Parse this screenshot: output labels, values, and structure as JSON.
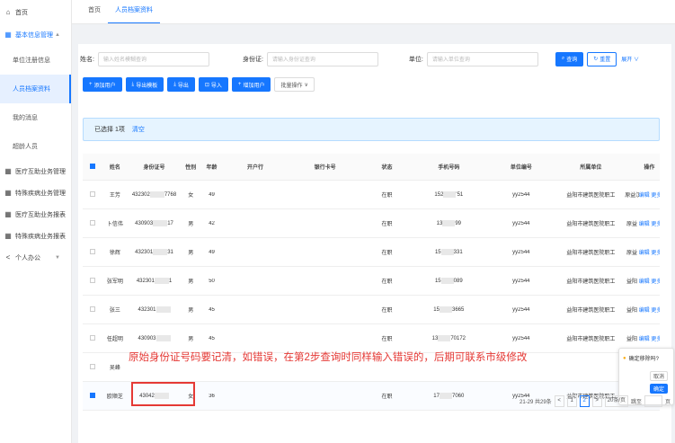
{
  "sidebar": {
    "home": "首页",
    "group1": "基本信息管理",
    "subs": [
      "单位注册信息",
      "人员档案资料",
      "我的消息",
      "超龄人员"
    ],
    "groups": [
      "医疗互助业务管理",
      "特殊疾病业务管理",
      "医疗互助业务报表",
      "特殊疾病业务报表",
      "个人办公"
    ]
  },
  "tabs": [
    "首页",
    "人员档案资料"
  ],
  "search": {
    "name_label": "姓名:",
    "name_ph": "输入姓名模糊查询",
    "id_label": "身份证:",
    "id_ph": "请输入身份证查询",
    "unit_label": "单位:",
    "unit_ph": "请输入单位查询",
    "query": "查询",
    "reset": "重置",
    "expand": "展开"
  },
  "toolbar": {
    "add": "添加用户",
    "tpl": "导出模板",
    "export": "导出",
    "import": "导入",
    "batch_add": "增加用户",
    "batch": "批量操作"
  },
  "selection": {
    "text": "已选择 1项",
    "clear": "清空"
  },
  "table": {
    "headers": [
      "姓名",
      "身份证号",
      "性别",
      "年龄",
      "开户行",
      "银行卡号",
      "状态",
      "手机号码",
      "单位编号",
      "所属单位",
      "",
      "操作"
    ],
    "rows": [
      {
        "name": "王芳",
        "id_pre": "432302",
        "id_suf": "7768",
        "sex": "女",
        "age": "49",
        "status": "在职",
        "ph_pre": "152",
        "ph_suf": "'51",
        "unit_no": "yy2544",
        "unit": "益阳市建筑医院职工",
        "dept": "原益汉药房",
        "op1": "编辑",
        "op2": "更多"
      },
      {
        "name": "卜信伟",
        "id_pre": "430903",
        "id_suf": "17",
        "sex": "男",
        "age": "42",
        "status": "在职",
        "ph_pre": "13",
        "ph_suf": "99",
        "unit_no": "yy2544",
        "unit": "益阳市建筑医院职工",
        "dept": "原益",
        "op1": "编辑",
        "op2": "更多"
      },
      {
        "name": "徐辉",
        "id_pre": "432301",
        "id_suf": "31",
        "sex": "男",
        "age": "49",
        "status": "在职",
        "ph_pre": "15",
        "ph_suf": "331",
        "unit_no": "yy2544",
        "unit": "益阳市建筑医院职工",
        "dept": "原益",
        "op1": "编辑",
        "op2": "更多"
      },
      {
        "name": "张军明",
        "id_pre": "432301",
        "id_suf": "1",
        "sex": "男",
        "age": "50",
        "status": "在职",
        "ph_pre": "15",
        "ph_suf": "089",
        "unit_no": "yy2544",
        "unit": "益阳市建筑医院职工",
        "dept": "益阳",
        "op1": "编辑",
        "op2": "更多"
      },
      {
        "name": "张三",
        "id_pre": "432301",
        "id_suf": "",
        "sex": "男",
        "age": "45",
        "status": "在职",
        "ph_pre": "15",
        "ph_suf": "3665",
        "unit_no": "yy2544",
        "unit": "益阳市建筑医院职工",
        "dept": "益阳",
        "op1": "编辑",
        "op2": "更多"
      },
      {
        "name": "任超明",
        "id_pre": "430903",
        "id_suf": "",
        "sex": "男",
        "age": "45",
        "status": "在职",
        "ph_pre": "13",
        "ph_suf": "70172",
        "unit_no": "yy2544",
        "unit": "益阳市建筑医院职工",
        "dept": "益阳",
        "op1": "编辑",
        "op2": "更多"
      },
      {
        "name": "吴峰",
        "id_pre": "",
        "id_suf": "",
        "sex": "",
        "age": "",
        "status": "",
        "ph_pre": "",
        "ph_suf": "",
        "unit_no": "",
        "unit": "",
        "dept": "",
        "op1": "",
        "op2": ""
      },
      {
        "name": "欧顺芝",
        "id_pre": "43042",
        "id_suf": "",
        "sex": "女",
        "age": "36",
        "status": "在职",
        "ph_pre": "17",
        "ph_suf": "7060",
        "unit_no": "yy2544",
        "unit": "益阳市建筑医院职工",
        "dept": "市",
        "op1": "编辑",
        "op2": "更多"
      }
    ]
  },
  "annotation": "原始身份证号码要记清，如错误，在第2步查询时同样输入错误的，后期可联系市级修改",
  "popover": {
    "text": "确定移除吗?",
    "cancel": "取消",
    "ok": "确定"
  },
  "pager": {
    "total": "21-29 共29条",
    "prev": "<",
    "p1": "1",
    "p2": "2",
    "next": ">",
    "size": "20条/页",
    "jump": "跳至",
    "page": "页"
  },
  "colors": {
    "primary": "#1677ff",
    "warn": "#e53935"
  }
}
